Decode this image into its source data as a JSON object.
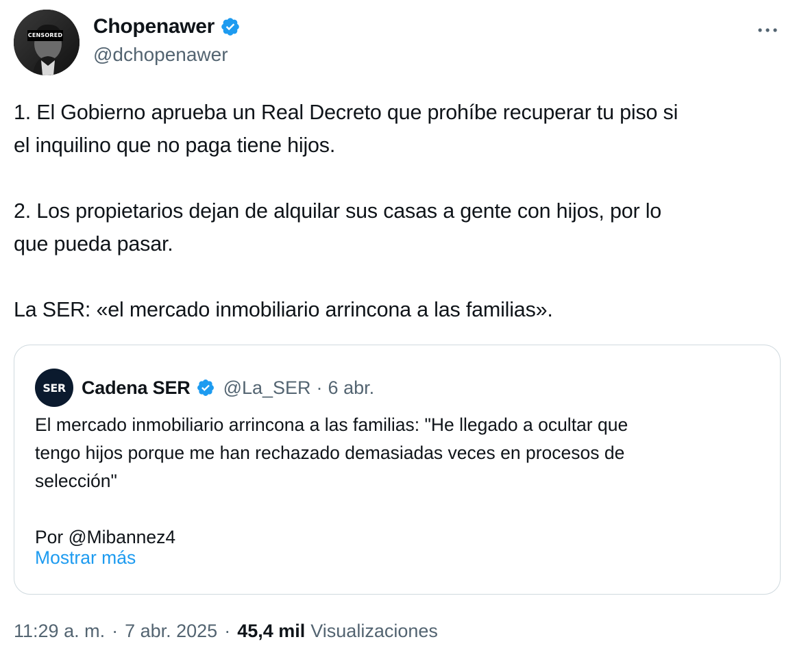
{
  "author": {
    "name": "Chopenawer",
    "handle": "@dchopenawer",
    "avatar_label": "CENSORED"
  },
  "tweet": {
    "paragraphs": [
      [
        "1. El Gobierno aprueba un Real Decreto que prohíbe recuperar tu piso si",
        "el inquilino que no paga tiene hijos."
      ],
      [
        "2. Los propietarios dejan de alquilar sus casas a gente con hijos, por lo",
        "que pueda pasar."
      ],
      [
        "La SER: «el mercado inmobiliario arrincona a las familias»."
      ]
    ]
  },
  "quote": {
    "logo_text": "SER",
    "name": "Cadena SER",
    "handle": "@La_SER",
    "separator": "·",
    "date": "6 abr.",
    "lines": [
      "El mercado inmobiliario arrincona a las familias: \"He llegado a ocultar que",
      "tengo hijos porque me han rechazado demasiadas veces en procesos de",
      "selección\"",
      "",
      "Por @Mibannez4"
    ],
    "show_more": "Mostrar más"
  },
  "meta": {
    "time": "11:29 a. m.",
    "separator": "·",
    "date": "7 abr. 2025",
    "views_count": "45,4 mil",
    "views_label": "Visualizaciones"
  },
  "colors": {
    "verified": "#1d9bf0",
    "link": "#1d9bf0",
    "secondary_text": "#536471",
    "border": "#cfd9de"
  },
  "icons": [
    "verified-badge-icon",
    "more-options-icon"
  ]
}
